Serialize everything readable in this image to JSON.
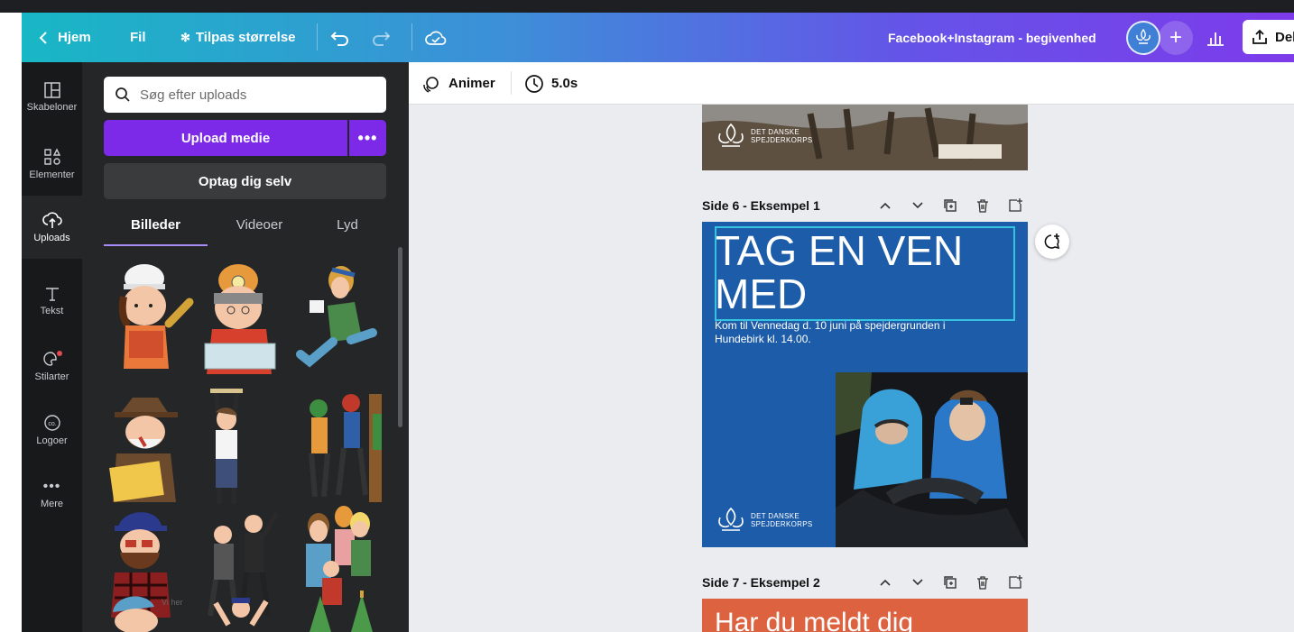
{
  "topbar": {
    "home_label": "Hjem",
    "file_label": "Fil",
    "resize_label": "Tilpas størrelse",
    "doc_title": "Facebook+Instagram - begivenhed",
    "share_label": "Del"
  },
  "rail": {
    "items": [
      {
        "label": "Skabeloner",
        "icon": "template-icon"
      },
      {
        "label": "Elementer",
        "icon": "elements-icon"
      },
      {
        "label": "Uploads",
        "icon": "cloud-upload-icon"
      },
      {
        "label": "Tekst",
        "icon": "text-icon"
      },
      {
        "label": "Stilarter",
        "icon": "palette-icon"
      },
      {
        "label": "Logoer",
        "icon": "logo-icon"
      },
      {
        "label": "Mere",
        "icon": "more-icon"
      }
    ],
    "active": "Uploads"
  },
  "panel": {
    "search_placeholder": "Søg efter uploads",
    "upload_label": "Upload medie",
    "more_label": "•••",
    "record_label": "Optag dig selv",
    "tabs": [
      "Billeder",
      "Videoer",
      "Lyd"
    ],
    "active_tab": "Billeder"
  },
  "toolbar": {
    "animate_label": "Animer",
    "duration_label": "5.0s"
  },
  "canvas": {
    "page6_label": "Side 6 - Eksempel 1",
    "page7_label": "Side 7 - Eksempel 2",
    "page6_headline": "TAG EN VEN MED",
    "page6_body": "Kom til Vennedag d. 10 juni på spejdergrunden i Hundebirk kl. 14.00.",
    "page7_headline": "Har du meldt dig",
    "logo_line1": "DET DANSKE",
    "logo_line2": "SPEJDERKORPS"
  },
  "colors": {
    "accent": "#7d2ae8",
    "page6_bg": "#1d5ca8",
    "page7_bg": "#dd6240",
    "selection": "#35c3df"
  }
}
